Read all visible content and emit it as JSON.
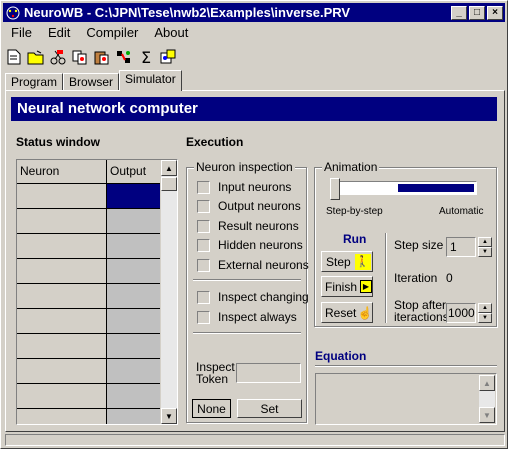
{
  "window": {
    "title": "NeuroWB - C:\\JPN\\Tese\\nwb2\\Examples\\inverse.PRV"
  },
  "menu": [
    "File",
    "Edit",
    "Compiler",
    "About"
  ],
  "toolbar_icons": [
    "new-file-icon",
    "open-folder-icon",
    "cut-neurons-icon",
    "copy-neurons-icon",
    "paste-neurons-icon",
    "compile-icon",
    "sum-icon",
    "properties-icon"
  ],
  "tabs": [
    "Program",
    "Browser",
    "Simulator"
  ],
  "banner": "Neural network computer",
  "status": {
    "title": "Status window",
    "col_neuron": "Neuron",
    "col_output": "Output"
  },
  "execution": {
    "title": "Execution"
  },
  "inspection": {
    "title": "Neuron inspection",
    "checks": [
      "Input neurons",
      "Output neurons",
      "Result neurons",
      "Hidden neurons",
      "External neurons"
    ],
    "checks2": [
      "Inspect changing",
      "Inspect always"
    ],
    "token_label_1": "Inspect",
    "token_label_2": "Token",
    "none_btn": "None",
    "set_btn": "Set"
  },
  "animation": {
    "title": "Animation",
    "left": "Step-by-step",
    "right": "Automatic",
    "level": 0.55
  },
  "run": {
    "title": "Run",
    "step_btn": "Step",
    "finish_btn": "Finish",
    "reset_btn": "Reset",
    "step_size_label": "Step size",
    "step_size": "1",
    "iteration_label": "Iteration",
    "iteration": "0",
    "stop_after_1": "Stop after",
    "stop_after_2": "iteractions",
    "stop_after_value": "1000"
  },
  "equation": {
    "title": "Equation"
  }
}
